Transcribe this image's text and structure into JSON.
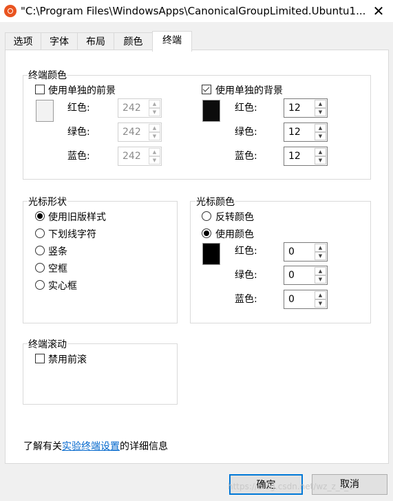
{
  "window": {
    "title": "\"C:\\Program Files\\WindowsApps\\CanonicalGroupLimited.Ubuntu1...",
    "close_glyph": "✕"
  },
  "tabs": [
    {
      "label": "选项"
    },
    {
      "label": "字体"
    },
    {
      "label": "布局"
    },
    {
      "label": "颜色"
    },
    {
      "label": "终端",
      "active": true
    }
  ],
  "terminal_colors": {
    "legend": "终端颜色",
    "foreground": {
      "checkbox_label": "使用单独的前景",
      "checked": false,
      "swatch_color": "#f2f2f2",
      "red_label": "红色:",
      "green_label": "绿色:",
      "blue_label": "蓝色:",
      "red": "242",
      "green": "242",
      "blue": "242"
    },
    "background": {
      "checkbox_label": "使用单独的背景",
      "checked": true,
      "swatch_color": "#0c0c0c",
      "red_label": "红色:",
      "green_label": "绿色:",
      "blue_label": "蓝色:",
      "red": "12",
      "green": "12",
      "blue": "12"
    }
  },
  "cursor_shape": {
    "legend": "光标形状",
    "options": [
      {
        "label": "使用旧版样式",
        "checked": true
      },
      {
        "label": "下划线字符",
        "checked": false
      },
      {
        "label": "竖条",
        "checked": false
      },
      {
        "label": "空框",
        "checked": false
      },
      {
        "label": "实心框",
        "checked": false
      }
    ]
  },
  "cursor_color": {
    "legend": "光标颜色",
    "invert_label": "反转颜色",
    "use_color_label": "使用颜色",
    "swatch_color": "#000000",
    "red_label": "红色:",
    "green_label": "绿色:",
    "blue_label": "蓝色:",
    "red": "0",
    "green": "0",
    "blue": "0"
  },
  "terminal_scrolling": {
    "legend": "终端滚动",
    "checkbox_label": "禁用前滚",
    "checked": false
  },
  "info": {
    "prefix": "了解有关",
    "link": "实验终端设置",
    "suffix": "的详细信息"
  },
  "buttons": {
    "ok": "确定",
    "cancel": "取消"
  },
  "watermark": "https://blog.csdn.net/wz_z_z_c"
}
